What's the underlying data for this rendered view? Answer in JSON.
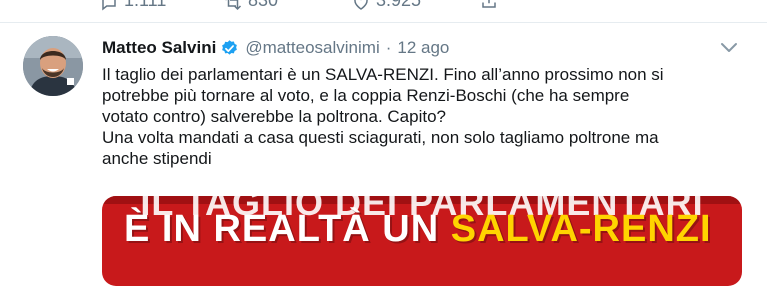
{
  "prev_tweet": {
    "replies_count": "1.111",
    "retweets_count": "830",
    "likes_count": "3.925"
  },
  "tweet": {
    "author_name": "Matteo Salvini",
    "handle": "@matteosalvinimi",
    "separator": "·",
    "time": "12 ago",
    "text_lines": [
      "Il taglio dei parlamentari è un SALVA-RENZI. Fino all’anno prossimo non si",
      "potrebbe più tornare al voto, e la coppia Renzi-Boschi (che ha sempre",
      "votato contro) salverebbe la poltrona. Capito?",
      "Una volta mandati a casa questi sciagurati, non solo tagliamo poltrone ma",
      "anche stipendi"
    ],
    "media": {
      "line1": "IL TAGLIO DEI PARLAMENTARI",
      "line2_prefix": "È IN REALTÀ UN ",
      "line2_highlight": "SALVA-RENZI"
    }
  },
  "colors": {
    "verified": "#1da1f2",
    "secondary_text": "#657786",
    "media_red": "#c8191b",
    "media_highlight": "#ffd400"
  }
}
